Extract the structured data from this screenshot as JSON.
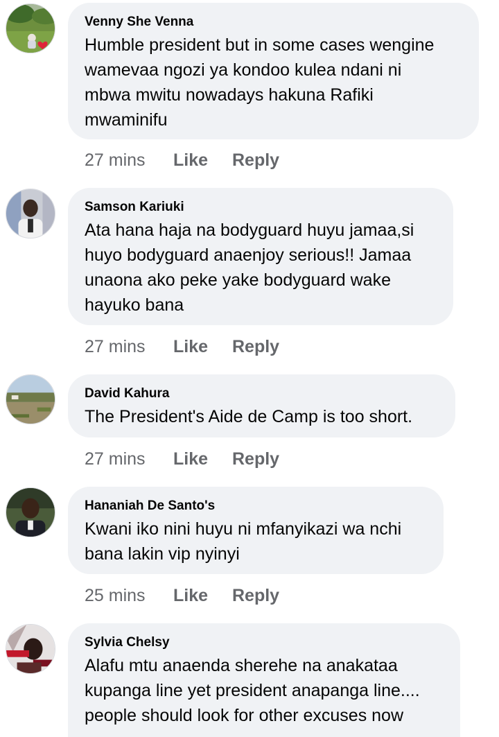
{
  "comments": [
    {
      "author": "Venny She Venna",
      "text": "Humble president but in some cases wengine\nwamevaa ngozi ya kondoo kulea ndani ni\nmbwa mwitu nowadays hakuna Rafiki\nmwaminifu",
      "time": "27 mins",
      "like": "Like",
      "reply": "Reply"
    },
    {
      "author": "Samson Kariuki",
      "text": "Ata hana haja na bodyguard huyu jamaa,si\nhuyo bodyguard anaenjoy serious!! Jamaa\nunaona ako peke yake bodyguard wake\nhayuko bana",
      "time": "27 mins",
      "like": "Like",
      "reply": "Reply"
    },
    {
      "author": "David Kahura",
      "text": "The President's Aide de Camp is too short.",
      "time": "27 mins",
      "like": "Like",
      "reply": "Reply"
    },
    {
      "author": "Hananiah De Santo's",
      "text": "Kwani iko nini huyu ni mfanyikazi wa nchi\nbana lakin vip nyinyi",
      "time": "25 mins",
      "like": "Like",
      "reply": "Reply"
    },
    {
      "author": "Sylvia Chelsy",
      "text": "Alafu mtu anaenda sherehe na anakataa\nkupanga line yet president anapanga line....\npeople should look for other excuses now",
      "time": "",
      "like": "",
      "reply": ""
    }
  ]
}
